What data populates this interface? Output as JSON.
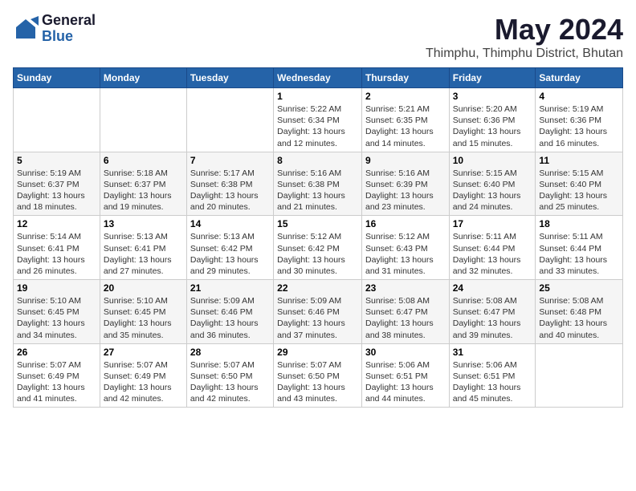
{
  "logo": {
    "general": "General",
    "blue": "Blue"
  },
  "header": {
    "month": "May 2024",
    "location": "Thimphu, Thimphu District, Bhutan"
  },
  "weekdays": [
    "Sunday",
    "Monday",
    "Tuesday",
    "Wednesday",
    "Thursday",
    "Friday",
    "Saturday"
  ],
  "weeks": [
    [
      {
        "day": "",
        "info": ""
      },
      {
        "day": "",
        "info": ""
      },
      {
        "day": "",
        "info": ""
      },
      {
        "day": "1",
        "info": "Sunrise: 5:22 AM\nSunset: 6:34 PM\nDaylight: 13 hours\nand 12 minutes."
      },
      {
        "day": "2",
        "info": "Sunrise: 5:21 AM\nSunset: 6:35 PM\nDaylight: 13 hours\nand 14 minutes."
      },
      {
        "day": "3",
        "info": "Sunrise: 5:20 AM\nSunset: 6:36 PM\nDaylight: 13 hours\nand 15 minutes."
      },
      {
        "day": "4",
        "info": "Sunrise: 5:19 AM\nSunset: 6:36 PM\nDaylight: 13 hours\nand 16 minutes."
      }
    ],
    [
      {
        "day": "5",
        "info": "Sunrise: 5:19 AM\nSunset: 6:37 PM\nDaylight: 13 hours\nand 18 minutes."
      },
      {
        "day": "6",
        "info": "Sunrise: 5:18 AM\nSunset: 6:37 PM\nDaylight: 13 hours\nand 19 minutes."
      },
      {
        "day": "7",
        "info": "Sunrise: 5:17 AM\nSunset: 6:38 PM\nDaylight: 13 hours\nand 20 minutes."
      },
      {
        "day": "8",
        "info": "Sunrise: 5:16 AM\nSunset: 6:38 PM\nDaylight: 13 hours\nand 21 minutes."
      },
      {
        "day": "9",
        "info": "Sunrise: 5:16 AM\nSunset: 6:39 PM\nDaylight: 13 hours\nand 23 minutes."
      },
      {
        "day": "10",
        "info": "Sunrise: 5:15 AM\nSunset: 6:40 PM\nDaylight: 13 hours\nand 24 minutes."
      },
      {
        "day": "11",
        "info": "Sunrise: 5:15 AM\nSunset: 6:40 PM\nDaylight: 13 hours\nand 25 minutes."
      }
    ],
    [
      {
        "day": "12",
        "info": "Sunrise: 5:14 AM\nSunset: 6:41 PM\nDaylight: 13 hours\nand 26 minutes."
      },
      {
        "day": "13",
        "info": "Sunrise: 5:13 AM\nSunset: 6:41 PM\nDaylight: 13 hours\nand 27 minutes."
      },
      {
        "day": "14",
        "info": "Sunrise: 5:13 AM\nSunset: 6:42 PM\nDaylight: 13 hours\nand 29 minutes."
      },
      {
        "day": "15",
        "info": "Sunrise: 5:12 AM\nSunset: 6:42 PM\nDaylight: 13 hours\nand 30 minutes."
      },
      {
        "day": "16",
        "info": "Sunrise: 5:12 AM\nSunset: 6:43 PM\nDaylight: 13 hours\nand 31 minutes."
      },
      {
        "day": "17",
        "info": "Sunrise: 5:11 AM\nSunset: 6:44 PM\nDaylight: 13 hours\nand 32 minutes."
      },
      {
        "day": "18",
        "info": "Sunrise: 5:11 AM\nSunset: 6:44 PM\nDaylight: 13 hours\nand 33 minutes."
      }
    ],
    [
      {
        "day": "19",
        "info": "Sunrise: 5:10 AM\nSunset: 6:45 PM\nDaylight: 13 hours\nand 34 minutes."
      },
      {
        "day": "20",
        "info": "Sunrise: 5:10 AM\nSunset: 6:45 PM\nDaylight: 13 hours\nand 35 minutes."
      },
      {
        "day": "21",
        "info": "Sunrise: 5:09 AM\nSunset: 6:46 PM\nDaylight: 13 hours\nand 36 minutes."
      },
      {
        "day": "22",
        "info": "Sunrise: 5:09 AM\nSunset: 6:46 PM\nDaylight: 13 hours\nand 37 minutes."
      },
      {
        "day": "23",
        "info": "Sunrise: 5:08 AM\nSunset: 6:47 PM\nDaylight: 13 hours\nand 38 minutes."
      },
      {
        "day": "24",
        "info": "Sunrise: 5:08 AM\nSunset: 6:47 PM\nDaylight: 13 hours\nand 39 minutes."
      },
      {
        "day": "25",
        "info": "Sunrise: 5:08 AM\nSunset: 6:48 PM\nDaylight: 13 hours\nand 40 minutes."
      }
    ],
    [
      {
        "day": "26",
        "info": "Sunrise: 5:07 AM\nSunset: 6:49 PM\nDaylight: 13 hours\nand 41 minutes."
      },
      {
        "day": "27",
        "info": "Sunrise: 5:07 AM\nSunset: 6:49 PM\nDaylight: 13 hours\nand 42 minutes."
      },
      {
        "day": "28",
        "info": "Sunrise: 5:07 AM\nSunset: 6:50 PM\nDaylight: 13 hours\nand 42 minutes."
      },
      {
        "day": "29",
        "info": "Sunrise: 5:07 AM\nSunset: 6:50 PM\nDaylight: 13 hours\nand 43 minutes."
      },
      {
        "day": "30",
        "info": "Sunrise: 5:06 AM\nSunset: 6:51 PM\nDaylight: 13 hours\nand 44 minutes."
      },
      {
        "day": "31",
        "info": "Sunrise: 5:06 AM\nSunset: 6:51 PM\nDaylight: 13 hours\nand 45 minutes."
      },
      {
        "day": "",
        "info": ""
      }
    ]
  ]
}
